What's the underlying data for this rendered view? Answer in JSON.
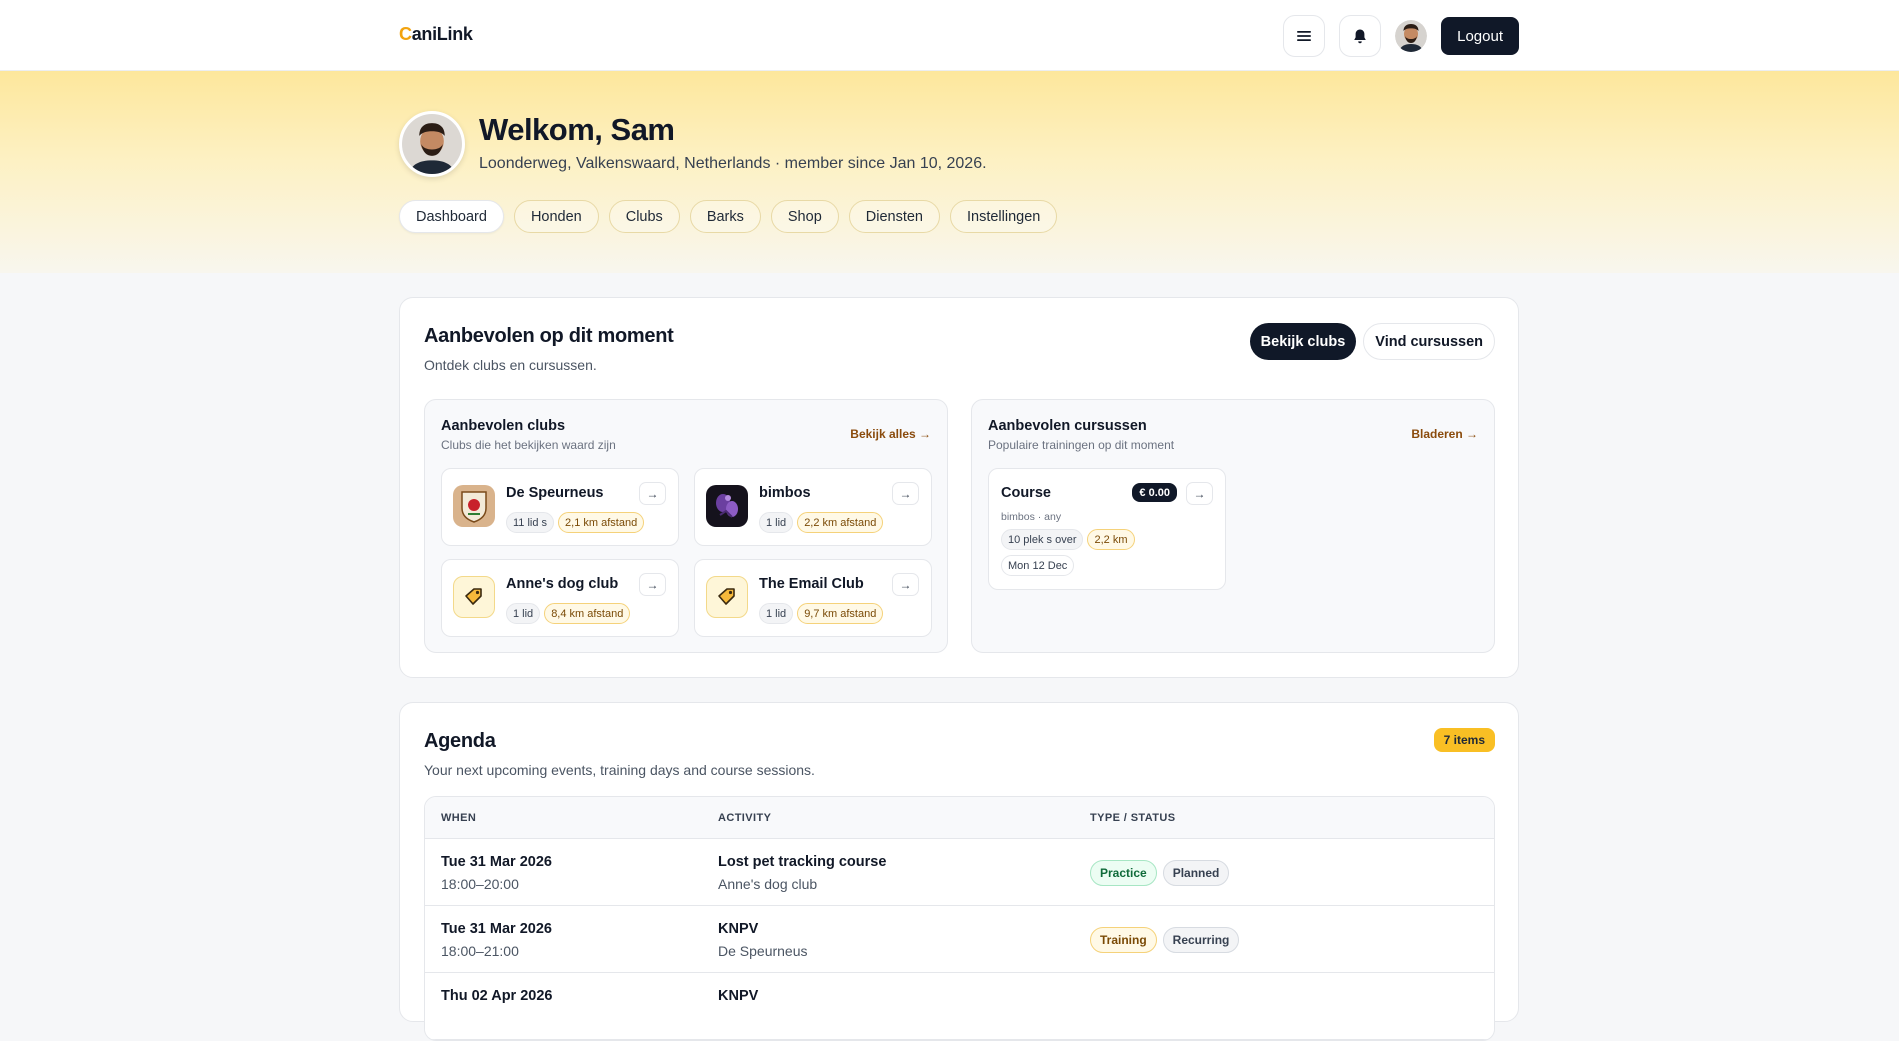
{
  "brand": {
    "first": "C",
    "rest": "aniLink"
  },
  "header": {
    "logout_label": "Logout"
  },
  "hero": {
    "title": "Welkom, Sam",
    "subtitle": "Loonderweg, Valkenswaard, Netherlands · member since Jan 10, 2026."
  },
  "tabs": [
    "Dashboard",
    "Honden",
    "Clubs",
    "Barks",
    "Shop",
    "Diensten",
    "Instellingen"
  ],
  "recommended": {
    "title": "Aanbevolen op dit moment",
    "subtitle": "Ontdek clubs en cursussen.",
    "btn_clubs": "Bekijk clubs",
    "btn_courses": "Vind cursussen",
    "clubs_panel": {
      "title": "Aanbevolen clubs",
      "subtitle": "Clubs die het bekijken waard zijn",
      "link": "Bekijk alles →",
      "items": [
        {
          "name": "De Speurneus",
          "members": "11 lid s",
          "distance": "2,1 km afstand",
          "arrow": "→"
        },
        {
          "name": "bimbos",
          "members": "1 lid",
          "distance": "2,2 km afstand",
          "arrow": "→"
        },
        {
          "name": "Anne's dog club",
          "members": "1 lid",
          "distance": "8,4 km afstand",
          "arrow": "→"
        },
        {
          "name": "The Email Club",
          "members": "1 lid",
          "distance": "9,7 km afstand",
          "arrow": "→"
        }
      ]
    },
    "courses_panel": {
      "title": "Aanbevolen cursussen",
      "subtitle": "Populaire trainingen op dit moment",
      "link": "Bladeren →",
      "course": {
        "name": "Course",
        "price": "€ 0.00",
        "meta": "bimbos · any",
        "spots": "10 plek s over",
        "distance": "2,2 km",
        "date": "Mon 12 Dec",
        "arrow": "→"
      }
    }
  },
  "agenda": {
    "title": "Agenda",
    "subtitle": "Your next upcoming events, training days and course sessions.",
    "count": "7 items",
    "columns": [
      "WHEN",
      "ACTIVITY",
      "TYPE / STATUS"
    ],
    "rows": [
      {
        "date": "Tue 31 Mar 2026",
        "time": "18:00–20:00",
        "activity": "Lost pet tracking course",
        "club": "Anne's dog club",
        "type": "Practice",
        "status": "Planned"
      },
      {
        "date": "Tue 31 Mar 2026",
        "time": "18:00–21:00",
        "activity": "KNPV",
        "club": "De Speurneus",
        "type": "Training",
        "status": "Recurring"
      },
      {
        "date": "Thu 02 Apr 2026",
        "time": "",
        "activity": "KNPV",
        "club": "",
        "type": "",
        "status": ""
      }
    ]
  },
  "colors": {
    "accent": "#f2a30f",
    "dark": "#101828",
    "hero_top": "#fde79c"
  }
}
